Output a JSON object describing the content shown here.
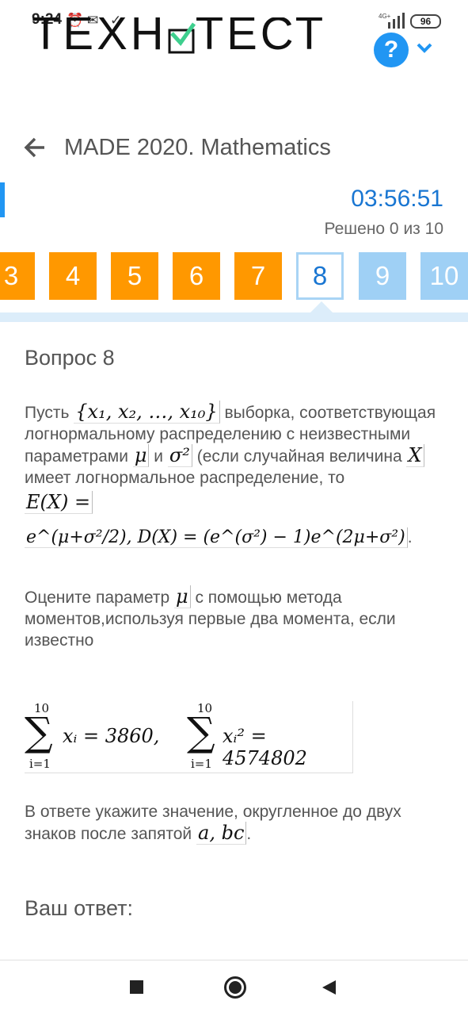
{
  "status_bar": {
    "time": "9:24",
    "icons": [
      "alarm-icon",
      "message-icon",
      "check-icon"
    ],
    "network": "4G+",
    "battery": "96"
  },
  "logo": {
    "left": "ТЕХН",
    "right": "ТЕСТ"
  },
  "header": {
    "back_icon": "arrow-left-icon",
    "title": "MADE 2020. Mathematics"
  },
  "timer": "03:56:51",
  "solved": "Решено 0 из 10",
  "tabs": [
    {
      "label": "3",
      "state": "answered"
    },
    {
      "label": "4",
      "state": "answered"
    },
    {
      "label": "5",
      "state": "answered"
    },
    {
      "label": "6",
      "state": "answered"
    },
    {
      "label": "7",
      "state": "answered"
    },
    {
      "label": "8",
      "state": "active"
    },
    {
      "label": "9",
      "state": "unanswered"
    },
    {
      "label": "10",
      "state": "unanswered"
    }
  ],
  "question": {
    "title": "Вопрос 8",
    "p1": {
      "t1": "Пусть",
      "m1": "{x₁, x₂, …, x₁₀}",
      "t2": "выборка, соответствующая логнормальному распределению с неизвестными параметрами",
      "m_mu": "μ",
      "t3": "и",
      "m_sigma": "σ²",
      "t4": "(если случайная величина",
      "m_x": "X",
      "t5": "имеет логнормальное распределение, то",
      "m_ex": "E(X) =",
      "m_formula": "e^(μ+σ²/2), D(X) = (e^(σ²) − 1)e^(2μ+σ²)",
      "end": "."
    },
    "p2": {
      "t1": "Оцените параметр",
      "m_mu": "μ",
      "t2": "с помощью метода моментов,используя первые два момента, если известно"
    },
    "sums": {
      "upper": "10",
      "lower": "i=1",
      "first": "xᵢ = 3860,",
      "second": "xᵢ² = 4574802"
    },
    "p3": {
      "t1": "В ответе укажите значение, округленное до двух знаков после запятой",
      "m_abc": "a, bc",
      "end": "."
    },
    "answer_label": "Ваш ответ:"
  },
  "colors": {
    "accent": "#2196f3",
    "timer": "#1976d2",
    "answered_tab": "#ff9800",
    "unanswered_tab": "#9fd0f5",
    "logo_check": "#3ecf8e"
  }
}
